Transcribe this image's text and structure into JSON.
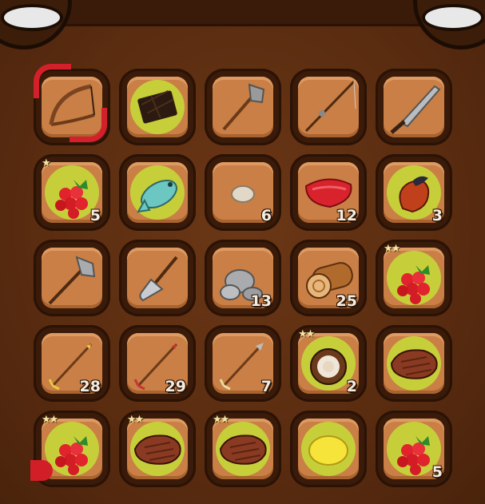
{
  "inventory": {
    "slots": [
      {
        "item": "bow",
        "selected": true
      },
      {
        "item": "chocolate-bar",
        "highlight": true
      },
      {
        "item": "stone-axe"
      },
      {
        "item": "fishing-rod"
      },
      {
        "item": "machete"
      },
      {
        "item": "raspberry",
        "count": "5",
        "stars": 1,
        "highlight": true
      },
      {
        "item": "fish",
        "highlight": true
      },
      {
        "item": "stone",
        "count": "6"
      },
      {
        "item": "raw-meat",
        "count": "12"
      },
      {
        "item": "roasted-pepper",
        "count": "3",
        "highlight": true
      },
      {
        "item": "iron-axe"
      },
      {
        "item": "shovel"
      },
      {
        "item": "rocks",
        "count": "13"
      },
      {
        "item": "wood-log",
        "count": "25"
      },
      {
        "item": "raspberry",
        "stars": 2,
        "highlight": true
      },
      {
        "item": "arrow-gold",
        "count": "28"
      },
      {
        "item": "arrow-red",
        "count": "29"
      },
      {
        "item": "arrow-stone",
        "count": "7"
      },
      {
        "item": "coconut",
        "count": "2",
        "stars": 2,
        "highlight": true
      },
      {
        "item": "steak",
        "highlight": true
      },
      {
        "item": "raspberry",
        "stars": 2,
        "highlight": true,
        "red_tab": true
      },
      {
        "item": "steak",
        "stars": 2,
        "highlight": true
      },
      {
        "item": "steak",
        "stars": 2,
        "highlight": true
      },
      {
        "item": "lemon",
        "highlight": true
      },
      {
        "item": "raspberry",
        "count": "5",
        "highlight": true
      }
    ]
  },
  "colors": {
    "background": "#5a2d12",
    "slot_fill": "#c97f45",
    "highlight": "#c6d43a",
    "selection": "#d4202a"
  }
}
